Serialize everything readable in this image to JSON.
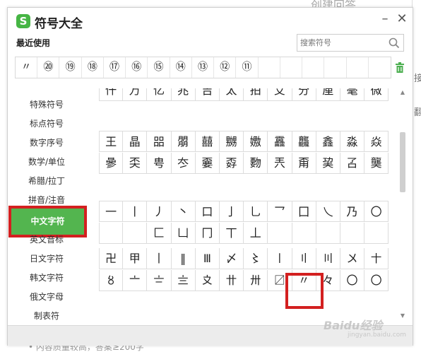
{
  "background": {
    "top_title": "创建回答",
    "right_chars": [
      "接",
      "翻"
    ],
    "bottom_text": "• 内容质量较高，答案≥200字"
  },
  "dialog": {
    "logo": "S",
    "title": "符号大全",
    "minimize_label": "–",
    "close_label": "✕",
    "recent_label": "最近使用",
    "search": {
      "placeholder": "搜索符号",
      "value": ""
    },
    "recent_symbols": [
      "〃",
      "⑳",
      "⑲",
      "⑱",
      "⑰",
      "⑯",
      "⑮",
      "⑭",
      "⑬",
      "⑫",
      "⑪",
      "",
      "",
      "",
      "",
      "",
      ""
    ],
    "categories": [
      {
        "label": "特殊符号",
        "active": false
      },
      {
        "label": "标点符号",
        "active": false
      },
      {
        "label": "数字序号",
        "active": false
      },
      {
        "label": "数学/单位",
        "active": false
      },
      {
        "label": "希腊/拉丁",
        "active": false
      },
      {
        "label": "拼音/注音",
        "active": false
      },
      {
        "label": "中文字符",
        "active": true
      },
      {
        "label": "英文音标",
        "active": false
      },
      {
        "label": "日文字符",
        "active": false
      },
      {
        "label": "韩文字符",
        "active": false
      },
      {
        "label": "俄文字母",
        "active": false
      },
      {
        "label": "制表符",
        "active": false
      }
    ],
    "symbol_rows": [
      [
        "仟",
        "万",
        "亿",
        "兆",
        "吉",
        "太",
        "拍",
        "艾",
        "分",
        "厘",
        "毫",
        "微"
      ],
      [
        "王",
        "晶",
        "㗊",
        "朤",
        "囍",
        "嬲",
        "嫐",
        "靐",
        "龘",
        "鑫",
        "淼",
        "焱"
      ],
      [
        "曑",
        "奀",
        "甹",
        "冭",
        "嫑",
        "孬",
        "覅",
        "兲",
        "甭",
        "巭",
        "叾",
        "龑"
      ],
      [
        "一",
        "丨",
        "丿",
        "丶",
        "口",
        "亅",
        "乚",
        "乛",
        "囗",
        "乀",
        "乃",
        "〇"
      ],
      [
        "",
        "",
        "匚",
        "凵",
        "冂",
        "丅",
        "丄",
        "",
        "",
        "",
        "",
        ""
      ],
      [
        "卍",
        "甲",
        "丨",
        "‖",
        "Ⅲ",
        "〆",
        "〻",
        "〡",
        "〢",
        "〣",
        "〤",
        "〸"
      ],
      [
        "〥",
        "〦",
        "〧",
        "〨",
        "〩",
        "〹",
        "〺",
        "〼",
        "〃",
        "々",
        "〇",
        "〇"
      ]
    ],
    "selected_symbol": "〃",
    "watermark": "Baidu经验",
    "watermark_sub": "jingyan.baidu.com"
  }
}
